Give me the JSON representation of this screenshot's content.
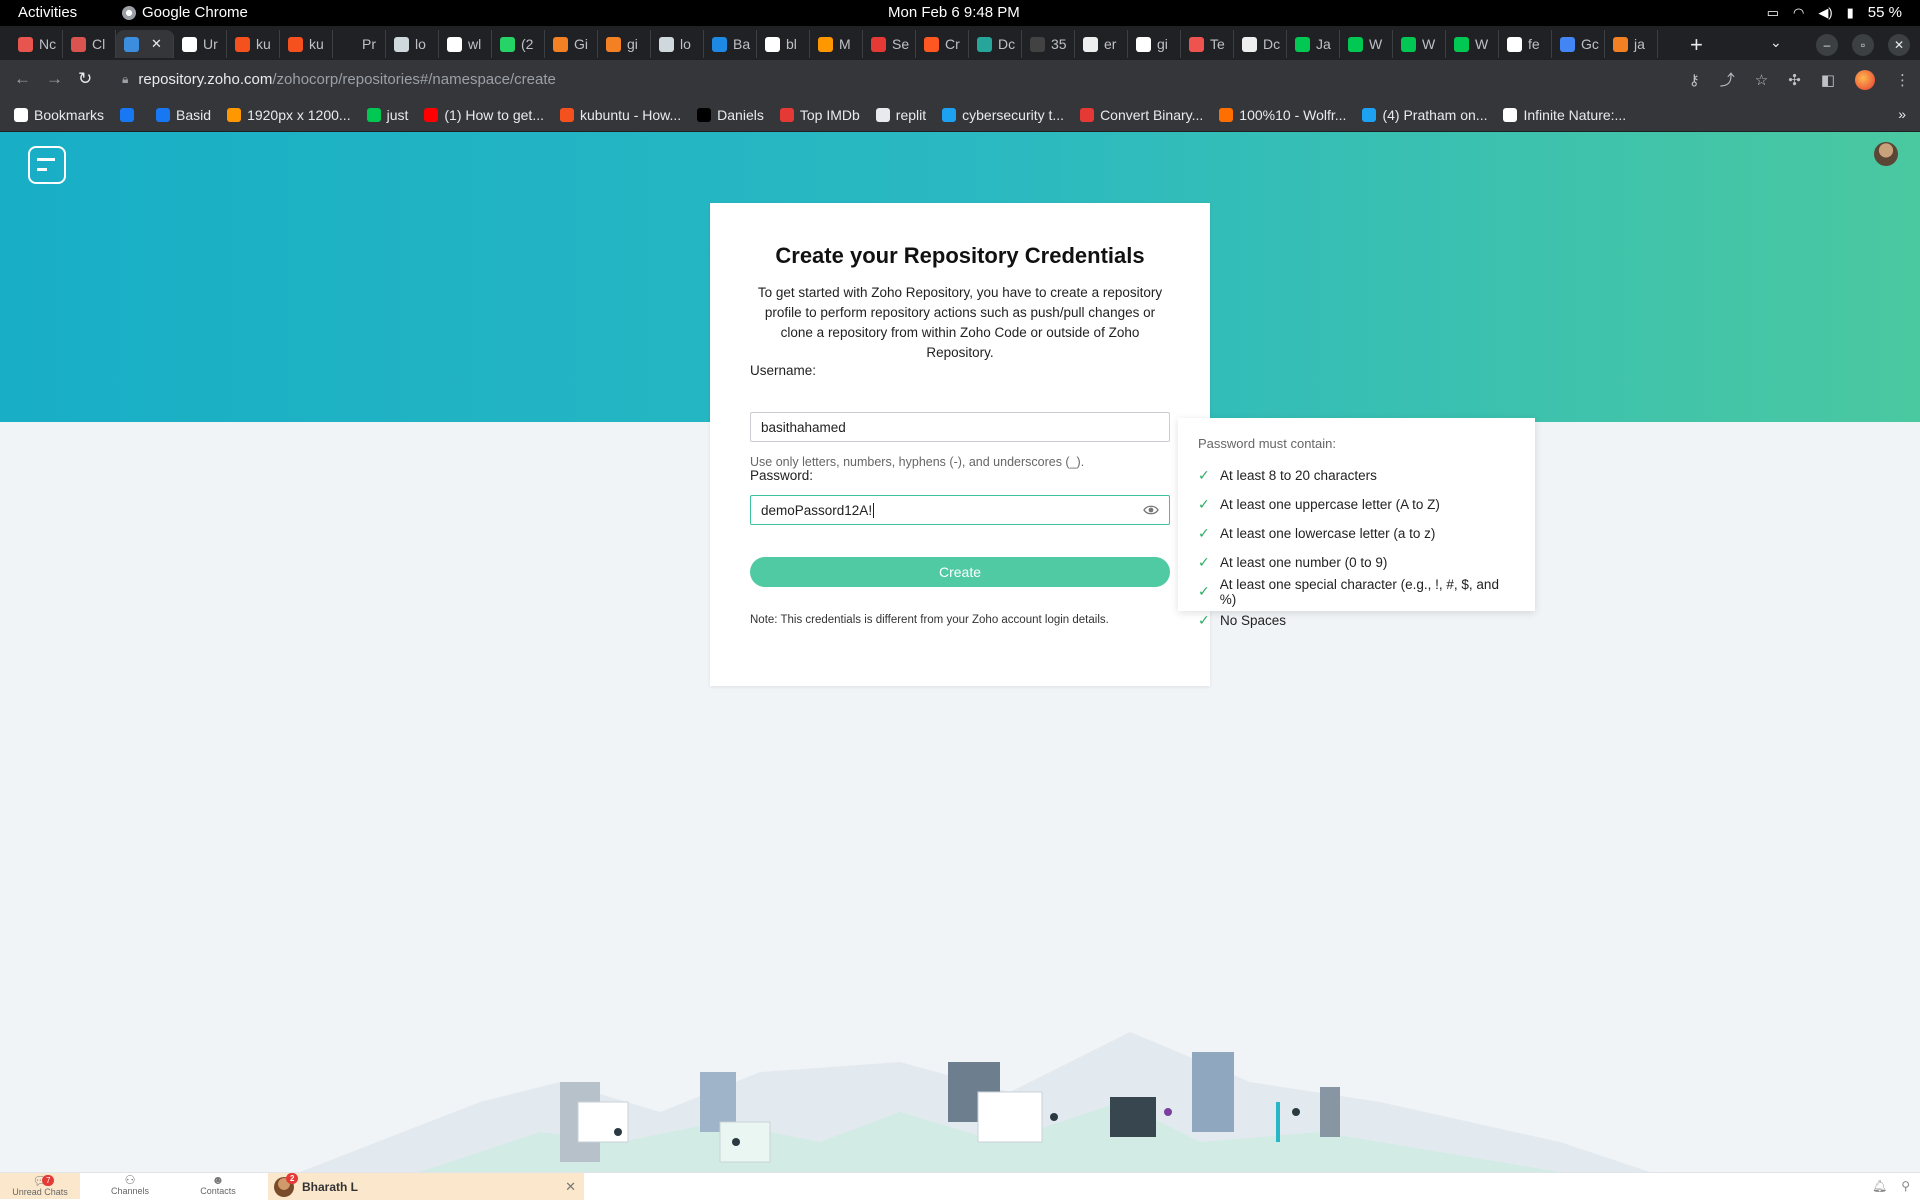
{
  "system": {
    "activities": "Activities",
    "app_name": "Google Chrome",
    "clock": "Mon Feb 6   9:48 PM",
    "battery": "55 %"
  },
  "browser": {
    "tabs": [
      {
        "label": "Nc",
        "color": "#e8554e"
      },
      {
        "label": "Cl",
        "color": "#d9534f"
      },
      {
        "label": "",
        "color": "#3c8dde",
        "active": true
      },
      {
        "label": "Ur",
        "color": "#ffffff"
      },
      {
        "label": "ku",
        "color": "#f4511e"
      },
      {
        "label": "ku",
        "color": "#f4511e"
      },
      {
        "label": "Pr",
        "color": "#202124"
      },
      {
        "label": "lo",
        "color": "#cfd8dc"
      },
      {
        "label": "wl",
        "color": "#ffffff"
      },
      {
        "label": "(2",
        "color": "#25d366"
      },
      {
        "label": "Gi",
        "color": "#f48024"
      },
      {
        "label": "gi",
        "color": "#f48024"
      },
      {
        "label": "lo",
        "color": "#cfd8dc"
      },
      {
        "label": "Ba",
        "color": "#1e88e5"
      },
      {
        "label": "bl",
        "color": "#ffffff"
      },
      {
        "label": "M",
        "color": "#ff9800"
      },
      {
        "label": "Se",
        "color": "#e53935"
      },
      {
        "label": "Cr",
        "color": "#ff5722"
      },
      {
        "label": "Dc",
        "color": "#26a69a"
      },
      {
        "label": "35",
        "color": "#424242"
      },
      {
        "label": "er",
        "color": "#eeeeee"
      },
      {
        "label": "gi",
        "color": "#ffffff"
      },
      {
        "label": "Te",
        "color": "#ef5350"
      },
      {
        "label": "Dc",
        "color": "#eeeeee"
      },
      {
        "label": "Ja",
        "color": "#00c853"
      },
      {
        "label": "W",
        "color": "#00c853"
      },
      {
        "label": "W",
        "color": "#00c853"
      },
      {
        "label": "W",
        "color": "#00c853"
      },
      {
        "label": "fe",
        "color": "#ffffff"
      },
      {
        "label": "Gc",
        "color": "#4285f4"
      },
      {
        "label": "ja",
        "color": "#f48024"
      }
    ],
    "url_host": "repository.zoho.com",
    "url_path": "/zohocorp/repositories#/namespace/create",
    "bookmarks": [
      {
        "label": "Bookmarks",
        "color": "#ffffff"
      },
      {
        "label": "",
        "color": "#1877f2"
      },
      {
        "label": "Basid",
        "color": "#1877f2"
      },
      {
        "label": "1920px x 1200...",
        "color": "#ff9800"
      },
      {
        "label": "just",
        "color": "#00c853"
      },
      {
        "label": "(1) How to get...",
        "color": "#ff0000"
      },
      {
        "label": "kubuntu - How...",
        "color": "#f4511e"
      },
      {
        "label": "Daniels",
        "color": "#000000"
      },
      {
        "label": "Top IMDb",
        "color": "#e53935"
      },
      {
        "label": "replit",
        "color": "#e8eaed"
      },
      {
        "label": "cybersecurity t...",
        "color": "#1da1f2"
      },
      {
        "label": "Convert Binary...",
        "color": "#e53935"
      },
      {
        "label": "100%10 - Wolfr...",
        "color": "#ff6f00"
      },
      {
        "label": "(4) Pratham on...",
        "color": "#1da1f2"
      },
      {
        "label": "Infinite Nature:...",
        "color": "#ffffff"
      }
    ]
  },
  "form": {
    "title": "Create your Repository Credentials",
    "description": "To get started with Zoho Repository, you have to create a repository profile to perform repository actions such as push/pull changes or clone a repository from within Zoho Code or outside of Zoho Repository.",
    "username_label": "Username:",
    "username_value": "basithahamed",
    "username_hint": "Use only letters, numbers, hyphens (-), and underscores (_).",
    "password_label": "Password:",
    "password_value": "demoPassord12A!",
    "create_label": "Create",
    "note": "Note: This credentials is different from your Zoho account login details."
  },
  "password_rules": {
    "title": "Password must contain:",
    "rules": [
      "At least 8 to 20 characters",
      "At least one uppercase letter (A to Z)",
      "At least one lowercase letter (a to z)",
      "At least one number (0 to 9)",
      "At least one special character (e.g., !, #, $, and %)",
      "No Spaces"
    ]
  },
  "chat": {
    "unread_label": "Unread Chats",
    "unread_count": "7",
    "channels_label": "Channels",
    "contacts_label": "Contacts",
    "active_chat": "Bharath L",
    "active_chat_count": "2"
  },
  "colors": {
    "hero_start": "#18aec6",
    "hero_end": "#4ac8a0",
    "accent": "#4fcaa2",
    "check": "#27ae60"
  }
}
